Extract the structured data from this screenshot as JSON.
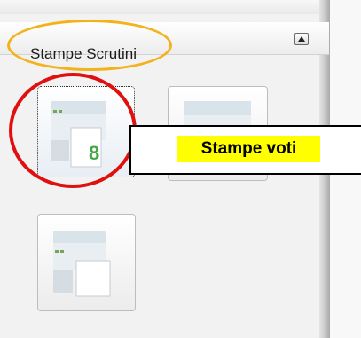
{
  "panel": {
    "title": "Stampe Scrutini",
    "collapse_icon": "collapse-up-icon"
  },
  "tiles": [
    {
      "icon": "print-grades-icon",
      "badge": "8",
      "selected": true
    },
    {
      "icon": "print-icon",
      "selected": false
    },
    {
      "icon": "print-document-icon",
      "selected": false
    }
  ],
  "annotation": {
    "callout_text": "Stampe voti",
    "colors": {
      "orange": "#f4b21a",
      "red": "#e01010",
      "highlight": "#ffff00"
    }
  }
}
